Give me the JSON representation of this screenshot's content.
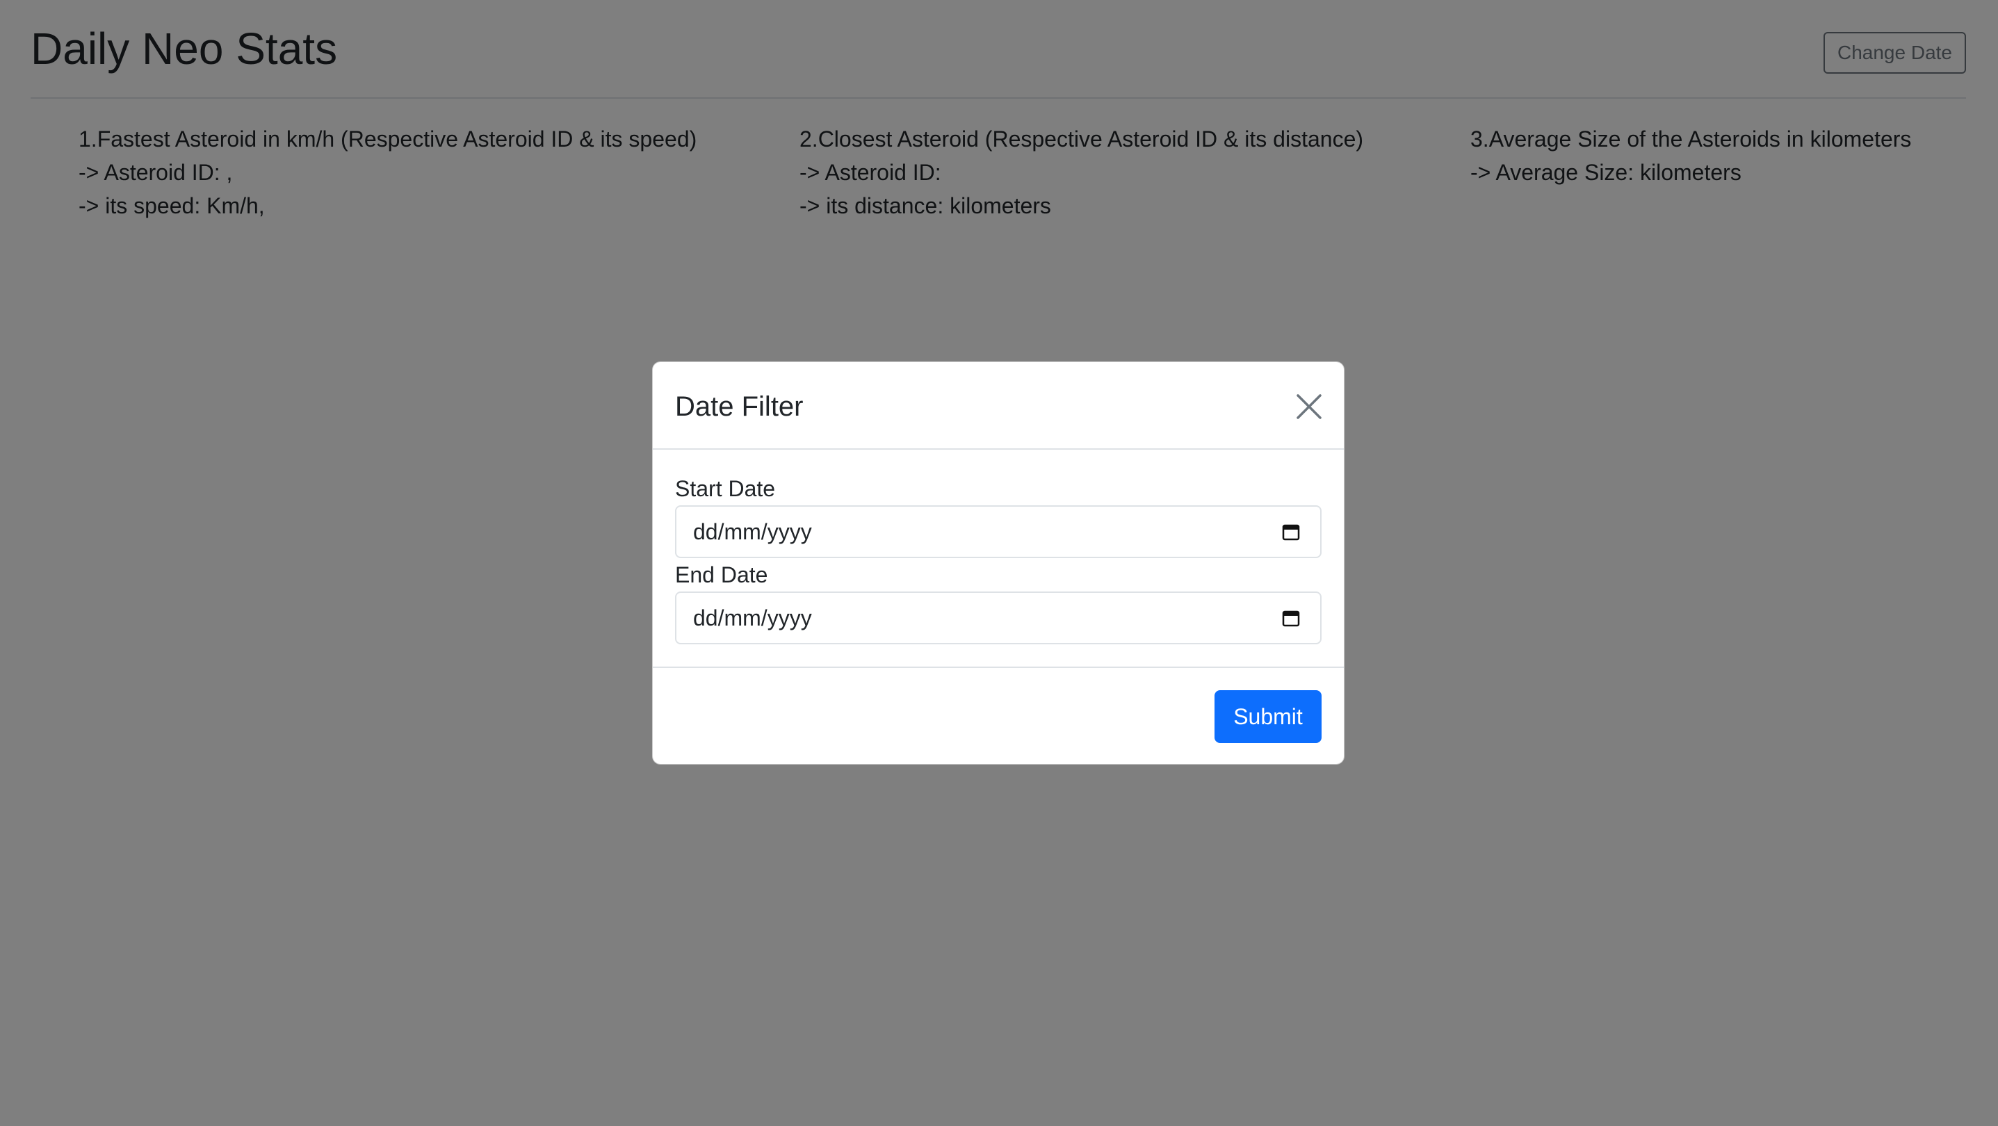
{
  "header": {
    "title": "Daily Neo Stats",
    "change_date_label": "Change Date"
  },
  "stats": {
    "fastest": {
      "heading": "1.Fastest Asteroid in km/h (Respective Asteroid ID & its speed)",
      "line1": "-> Asteroid ID: ,",
      "line2": "-> its speed: Km/h,"
    },
    "closest": {
      "heading": "2.Closest Asteroid (Respective Asteroid ID & its distance)",
      "line1": "-> Asteroid ID:",
      "line2": "-> its distance: kilometers"
    },
    "average": {
      "heading": "3.Average Size of the Asteroids in kilometers",
      "line1": "-> Average Size: kilometers"
    }
  },
  "modal": {
    "title": "Date Filter",
    "start_label": "Start Date",
    "start_placeholder": "dd/mm/yyyy",
    "end_label": "End Date",
    "end_placeholder": "dd/mm/yyyy",
    "submit_label": "Submit"
  },
  "colors": {
    "primary": "#0d6efd",
    "secondary": "#6c757d",
    "backdrop": "rgba(0,0,0,0.5)"
  },
  "icons": {
    "close": "close-icon",
    "calendar": "calendar-icon"
  }
}
